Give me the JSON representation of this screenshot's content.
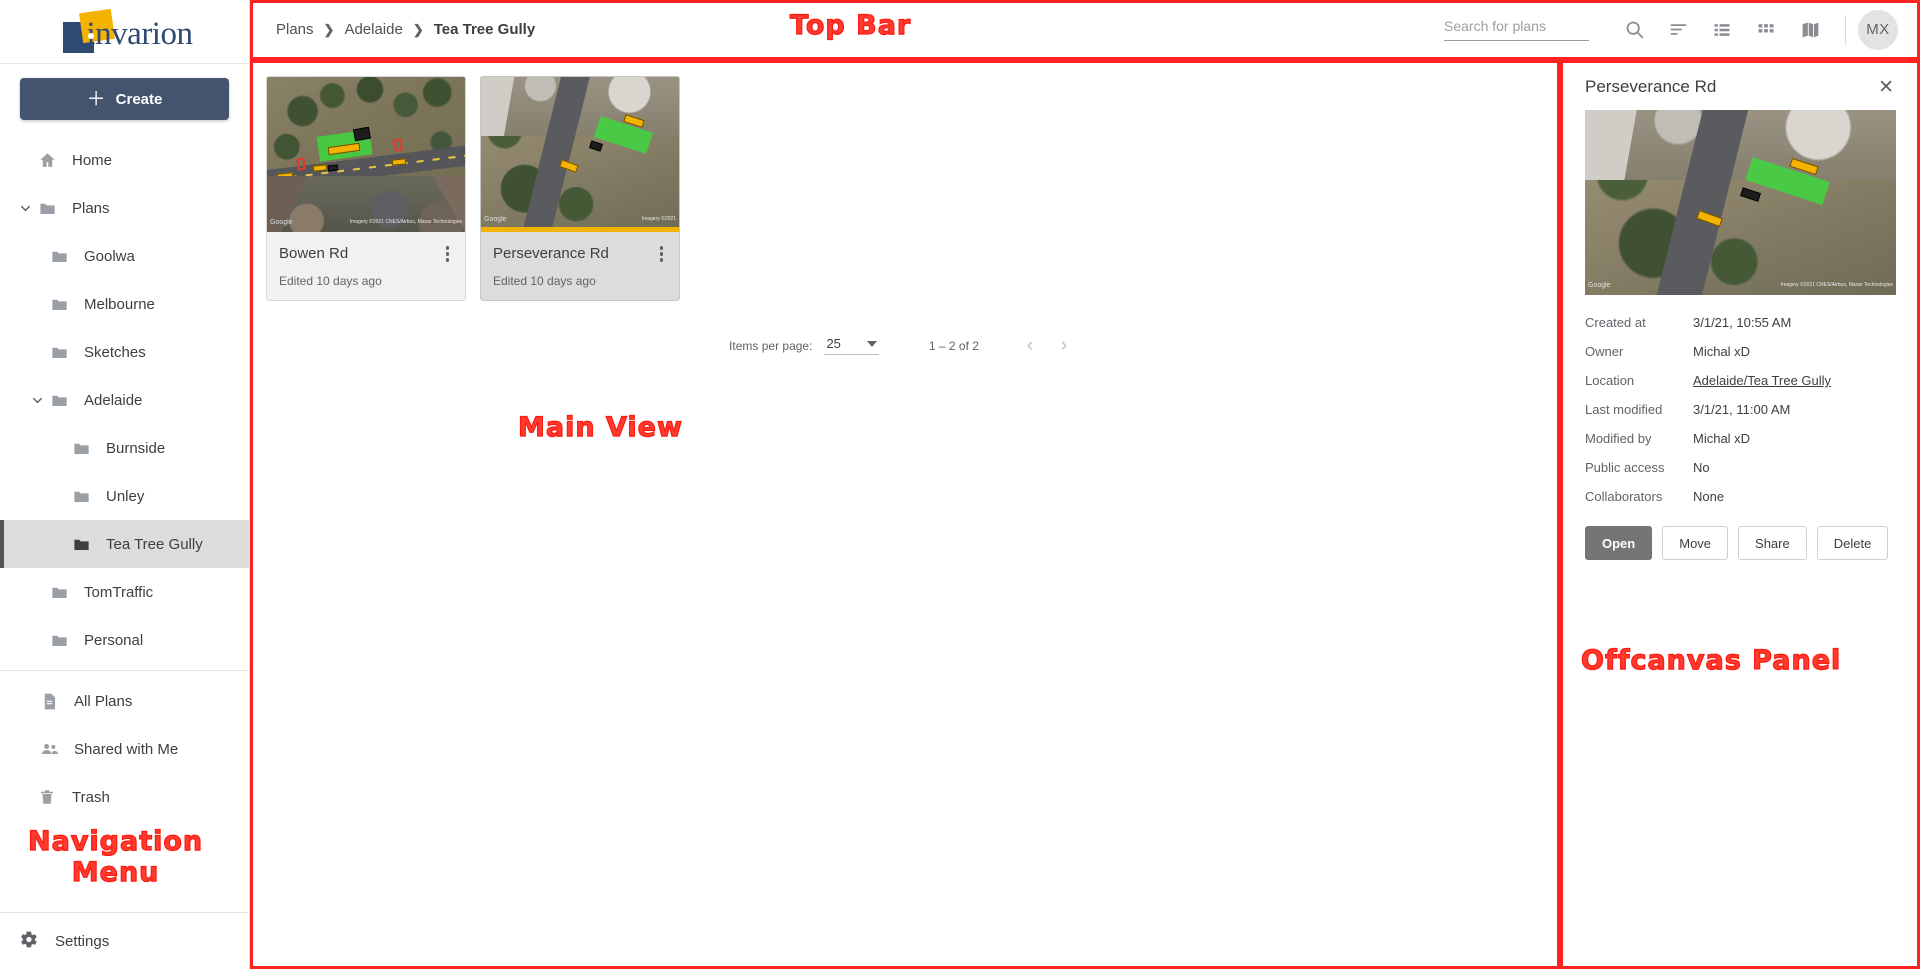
{
  "brand": {
    "name": "invarion"
  },
  "sidebar": {
    "create_label": "Create",
    "items": [
      {
        "label": "Home",
        "icon": "home-icon",
        "level": 1,
        "expandable": false,
        "selected": false
      },
      {
        "label": "Plans",
        "icon": "folder-icon",
        "level": 1,
        "expandable": true,
        "expanded": true,
        "selected": false
      },
      {
        "label": "Goolwa",
        "icon": "folder-icon",
        "level": 2,
        "expandable": false,
        "selected": false
      },
      {
        "label": "Melbourne",
        "icon": "folder-icon",
        "level": 2,
        "expandable": false,
        "selected": false
      },
      {
        "label": "Sketches",
        "icon": "folder-icon",
        "level": 2,
        "expandable": false,
        "selected": false
      },
      {
        "label": "Adelaide",
        "icon": "folder-icon",
        "level": 2,
        "expandable": true,
        "expanded": true,
        "selected": false
      },
      {
        "label": "Burnside",
        "icon": "folder-icon",
        "level": 3,
        "expandable": false,
        "selected": false
      },
      {
        "label": "Unley",
        "icon": "folder-icon",
        "level": 3,
        "expandable": false,
        "selected": false
      },
      {
        "label": "Tea Tree Gully",
        "icon": "folder-icon",
        "level": 3,
        "expandable": false,
        "selected": true
      },
      {
        "label": "TomTraffic",
        "icon": "folder-icon",
        "level": 2,
        "expandable": false,
        "selected": false
      },
      {
        "label": "Personal",
        "icon": "folder-icon",
        "level": 2,
        "expandable": false,
        "selected": false
      }
    ],
    "secondary_items": [
      {
        "label": "All Plans",
        "icon": "document-icon"
      },
      {
        "label": "Shared with Me",
        "icon": "people-icon"
      },
      {
        "label": "Trash",
        "icon": "trash-icon"
      }
    ],
    "settings_label": "Settings"
  },
  "topbar": {
    "breadcrumb": [
      {
        "label": "Plans",
        "active": false
      },
      {
        "label": "Adelaide",
        "active": false
      },
      {
        "label": "Tea Tree Gully",
        "active": true
      }
    ],
    "search_placeholder": "Search for plans",
    "search_value": "",
    "tools": [
      {
        "name": "search-icon",
        "title": "Search"
      },
      {
        "name": "sort-icon",
        "title": "Sort"
      },
      {
        "name": "list-view-icon",
        "title": "List view"
      },
      {
        "name": "grid-view-icon",
        "title": "Grid view"
      },
      {
        "name": "map-view-icon",
        "title": "Map view"
      }
    ],
    "avatar_initials": "MX"
  },
  "main": {
    "cards": [
      {
        "title": "Bowen Rd",
        "subtitle": "Edited 10 days ago",
        "selected": false
      },
      {
        "title": "Perseverance Rd",
        "subtitle": "Edited 10 days ago",
        "selected": true
      }
    ],
    "paginator": {
      "items_per_page_label": "Items per page:",
      "items_per_page_value": "25",
      "range_label": "1 – 2 of 2",
      "prev_label": "‹",
      "next_label": "›"
    }
  },
  "offcanvas": {
    "title": "Perseverance Rd",
    "close_label": "✕",
    "meta": [
      {
        "key": "Created at",
        "value": "3/1/21, 10:55 AM",
        "link": false
      },
      {
        "key": "Owner",
        "value": "Michal xD",
        "link": false
      },
      {
        "key": "Location",
        "value": "Adelaide/Tea Tree Gully",
        "link": true
      },
      {
        "key": "Last modified",
        "value": "3/1/21, 11:00 AM",
        "link": false
      },
      {
        "key": "Modified by",
        "value": "Michal xD",
        "link": false
      },
      {
        "key": "Public access",
        "value": "No",
        "link": false
      },
      {
        "key": "Collaborators",
        "value": "None",
        "link": false
      }
    ],
    "actions": [
      {
        "label": "Open",
        "primary": true
      },
      {
        "label": "Move",
        "primary": false
      },
      {
        "label": "Share",
        "primary": false
      },
      {
        "label": "Delete",
        "primary": false
      }
    ]
  },
  "annotations": {
    "navigation_menu": "Navigation\nMenu",
    "top_bar": "Top Bar",
    "main_view": "Main View",
    "offcanvas_panel": "Offcanvas Panel"
  },
  "colors": {
    "accent_blue": "#2e4a72",
    "accent_yellow": "#f5b301",
    "create_button": "#44546e",
    "annotation_red": "#ff3b30",
    "selected_row": "#dcdcdc"
  }
}
